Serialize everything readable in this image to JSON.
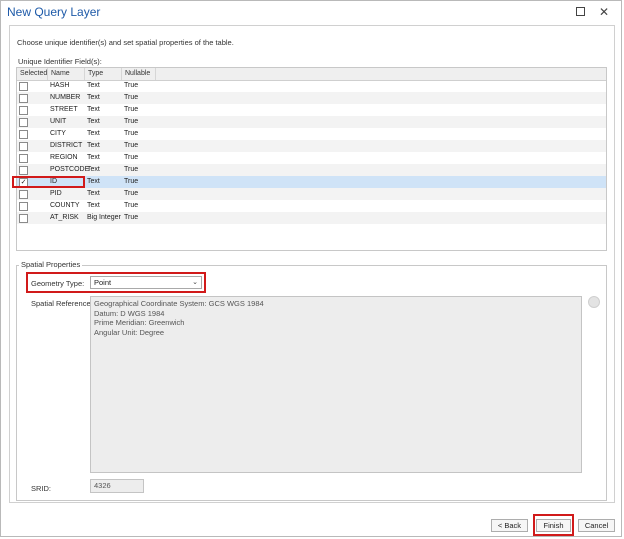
{
  "window": {
    "title": "New Query Layer",
    "maximize_icon": "maximize-icon",
    "close_glyph": "✕"
  },
  "instruction": "Choose unique identifier(s) and set spatial properties of the table.",
  "uid_label": "Unique Identifier Field(s):",
  "grid": {
    "columns": [
      "Selected",
      "Name",
      "Type",
      "Nullable"
    ],
    "rows": [
      {
        "selected": false,
        "name": "HASH",
        "type": "Text",
        "nullable": "True"
      },
      {
        "selected": false,
        "name": "NUMBER",
        "type": "Text",
        "nullable": "True"
      },
      {
        "selected": false,
        "name": "STREET",
        "type": "Text",
        "nullable": "True"
      },
      {
        "selected": false,
        "name": "UNIT",
        "type": "Text",
        "nullable": "True"
      },
      {
        "selected": false,
        "name": "CITY",
        "type": "Text",
        "nullable": "True"
      },
      {
        "selected": false,
        "name": "DISTRICT",
        "type": "Text",
        "nullable": "True"
      },
      {
        "selected": false,
        "name": "REGION",
        "type": "Text",
        "nullable": "True"
      },
      {
        "selected": false,
        "name": "POSTCODE",
        "type": "Text",
        "nullable": "True"
      },
      {
        "selected": true,
        "name": "ID",
        "type": "Text",
        "nullable": "True"
      },
      {
        "selected": false,
        "name": "PID",
        "type": "Text",
        "nullable": "True"
      },
      {
        "selected": false,
        "name": "COUNTY",
        "type": "Text",
        "nullable": "True"
      },
      {
        "selected": false,
        "name": "AT_RISK",
        "type": "Big Integer",
        "nullable": "True"
      }
    ]
  },
  "spatial": {
    "legend": "Spatial Properties",
    "geometry_label": "Geometry Type:",
    "geometry_value": "Point",
    "sr_label": "Spatial Reference:",
    "sr_lines": [
      "Geographical Coordinate System:  GCS WGS 1984",
      "Datum:  D WGS 1984",
      "Prime Meridian:  Greenwich",
      "Angular Unit:  Degree"
    ],
    "srid_label": "SRID:",
    "srid_value": "4326"
  },
  "buttons": {
    "back": "< Back",
    "finish": "Finish",
    "cancel": "Cancel"
  },
  "colors": {
    "title": "#1e5aa8",
    "highlight": "#d11a1a",
    "selected_row": "#cfe3f7"
  }
}
